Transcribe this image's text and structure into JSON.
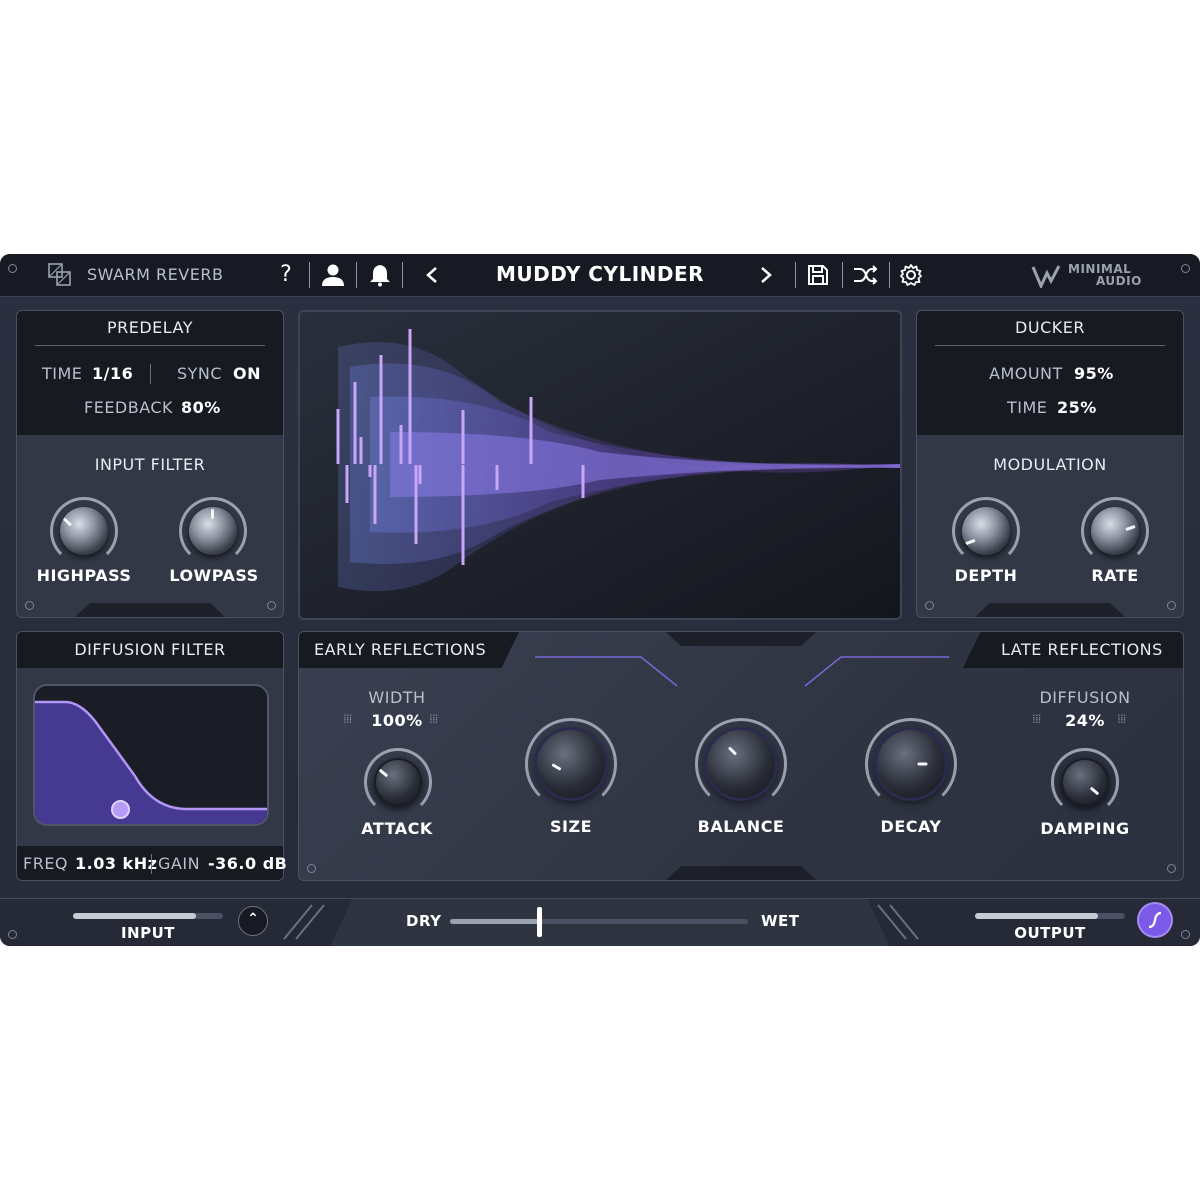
{
  "header": {
    "app_name": "SWARM REVERB",
    "preset_name": "MUDDY CYLINDER",
    "brand_line1": "MINIMAL",
    "brand_line2": "AUDIO",
    "icons": [
      "plugin-logo-icon",
      "help-icon",
      "user-icon",
      "bell-icon",
      "prev-preset-icon",
      "next-preset-icon",
      "save-icon",
      "shuffle-icon",
      "settings-icon",
      "brand-logo-icon"
    ]
  },
  "predelay": {
    "title": "PREDELAY",
    "time_label": "TIME",
    "time_value": "1/16",
    "sync_label": "SYNC",
    "sync_value": "ON",
    "feedback_label": "FEEDBACK",
    "feedback_value": "80%"
  },
  "input_filter": {
    "title": "INPUT FILTER",
    "highpass": "HIGHPASS",
    "lowpass": "LOWPASS"
  },
  "ducker": {
    "title": "DUCKER",
    "amount_label": "AMOUNT",
    "amount_value": "95%",
    "time_label": "TIME",
    "time_value": "25%"
  },
  "modulation": {
    "title": "MODULATION",
    "depth": "DEPTH",
    "rate": "RATE"
  },
  "diffusion_filter": {
    "title": "DIFFUSION FILTER",
    "freq_label": "FREQ",
    "freq_value": "1.03 kHz",
    "gain_label": "GAIN",
    "gain_value": "-36.0 dB"
  },
  "early": {
    "title": "EARLY REFLECTIONS",
    "width_label": "WIDTH",
    "width_value": "100%",
    "attack": "ATTACK"
  },
  "center": {
    "size": "SIZE",
    "balance": "BALANCE",
    "decay": "DECAY"
  },
  "late": {
    "title": "LATE REFLECTIONS",
    "diffusion_label": "DIFFUSION",
    "diffusion_value": "24%",
    "damping": "DAMPING"
  },
  "footer": {
    "input_label": "INPUT",
    "output_label": "OUTPUT",
    "dry_label": "DRY",
    "wet_label": "WET",
    "dry_wet_position": 0.3
  },
  "colors": {
    "accent": "#8f6cf0",
    "accent_light": "#c49cf5",
    "panel": "#323846",
    "bar": "#171a22"
  }
}
